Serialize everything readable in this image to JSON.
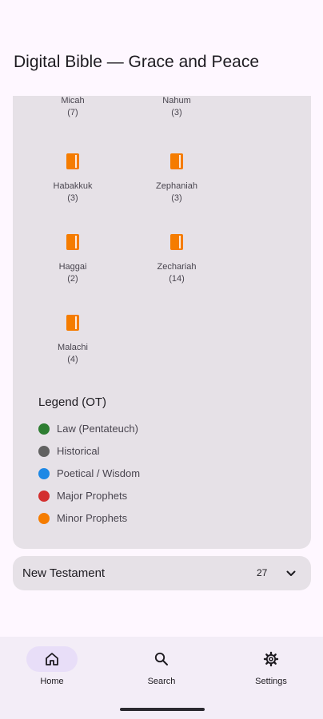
{
  "app": {
    "title": "Digital Bible — Grace and Peace"
  },
  "books": [
    {
      "name": "Micah",
      "count": "(7)",
      "color": "#F57C00"
    },
    {
      "name": "Nahum",
      "count": "(3)",
      "color": "#F57C00"
    },
    {
      "name": "Habakkuk",
      "count": "(3)",
      "color": "#F57C00"
    },
    {
      "name": "Zephaniah",
      "count": "(3)",
      "color": "#F57C00"
    },
    {
      "name": "Haggai",
      "count": "(2)",
      "color": "#F57C00"
    },
    {
      "name": "Zechariah",
      "count": "(14)",
      "color": "#F57C00"
    },
    {
      "name": "Malachi",
      "count": "(4)",
      "color": "#F57C00"
    }
  ],
  "legend": {
    "title": "Legend (OT)",
    "items": [
      {
        "label": "Law (Pentateuch)",
        "color": "#2E7D32"
      },
      {
        "label": "Historical",
        "color": "#616161"
      },
      {
        "label": "Poetical / Wisdom",
        "color": "#1E88E5"
      },
      {
        "label": "Major Prophets",
        "color": "#D32F2F"
      },
      {
        "label": "Minor Prophets",
        "color": "#F57C00"
      }
    ]
  },
  "new_testament": {
    "label": "New Testament",
    "count": "27",
    "icon": "chevron-down-icon"
  },
  "nav": {
    "items": [
      {
        "label": "Home",
        "icon": "home-icon",
        "active": true
      },
      {
        "label": "Search",
        "icon": "search-icon",
        "active": false
      },
      {
        "label": "Settings",
        "icon": "gear-icon",
        "active": false
      }
    ]
  }
}
